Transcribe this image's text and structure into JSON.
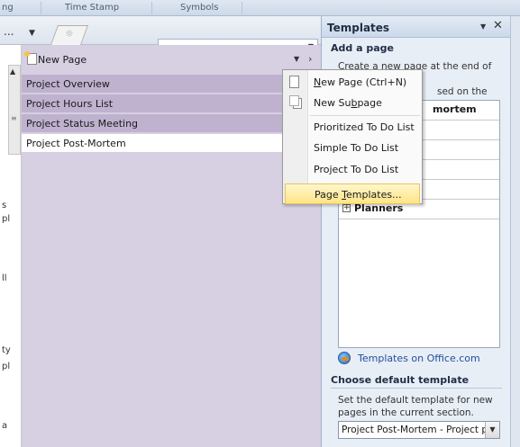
{
  "ribbon": {
    "fragments": [
      "ng",
      "Time Stamp",
      "Symbols"
    ]
  },
  "left_area": {
    "partial_chars": [
      "s",
      "pl",
      "ll",
      "ty",
      "pl",
      "a"
    ]
  },
  "tabs": {
    "ellipsis": "...",
    "dropdown_glyph": "▼",
    "new_tab_glyph": "☼"
  },
  "search": {
    "value": "",
    "arrow": "▼"
  },
  "page_panel": {
    "new_page_label": "New Page",
    "header_down_glyph": "▼",
    "header_right_glyph": "›",
    "pages": [
      {
        "label": "Project Overview",
        "selected": false
      },
      {
        "label": "Project Hours List",
        "selected": false
      },
      {
        "label": "Project Status Meeting",
        "selected": false
      },
      {
        "label": "Project Post-Mortem",
        "selected": true
      }
    ]
  },
  "context_menu": {
    "new_page": {
      "pre": "",
      "accel": "N",
      "post": "ew Page  (Ctrl+N)"
    },
    "new_subpage": {
      "pre": "New Su",
      "accel": "b",
      "post": "page"
    },
    "prioritized_todo": "Prioritized To Do List",
    "simple_todo": "Simple To Do List",
    "project_todo": "Project To Do List",
    "page_templates": {
      "pre": "Page ",
      "accel": "T",
      "post": "emplates..."
    }
  },
  "templates_pane": {
    "title": "Templates",
    "caret": "▼",
    "close": "✕",
    "add_page_heading": "Add a page",
    "add_page_desc": "Create a new page at the end of the current section based on the selected template.",
    "add_page_desc_visible_line1": "Create a new page at the end of the",
    "add_page_desc_visible_line2": "sed on the",
    "add_page_desc_visible_line3": "e.",
    "list_rows": [
      {
        "label": "mortem",
        "type": "bold-partial"
      },
      {
        "label": "",
        "type": "blank"
      },
      {
        "label": "",
        "type": "blank"
      },
      {
        "label": "",
        "type": "blank"
      },
      {
        "label": "",
        "type": "blank"
      },
      {
        "label": "Planners",
        "type": "group"
      }
    ],
    "plus": "+",
    "office_link": "Templates on Office.com",
    "choose_heading": "Choose default template",
    "choose_desc": "Set the default template for new pages in the current section.",
    "default_value": "Project Post-Mortem - Project pos",
    "default_arrow": "▼"
  }
}
